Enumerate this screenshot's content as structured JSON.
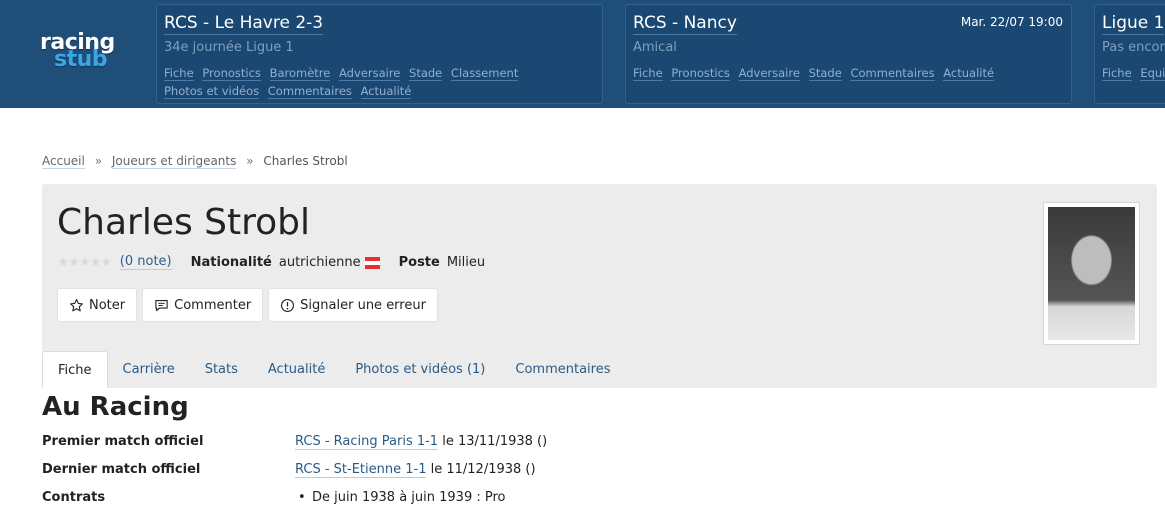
{
  "header": {
    "logo": {
      "word1": "racing",
      "word2": "stub"
    },
    "cards": [
      {
        "title": "RCS - Le Havre 2-3",
        "date": "",
        "subtitle": "34e journée Ligue 1",
        "links": [
          "Fiche",
          "Pronostics",
          "Baromètre",
          "Adversaire",
          "Stade",
          "Classement",
          "Photos et vidéos",
          "Commentaires",
          "Actualité"
        ]
      },
      {
        "title": "RCS - Nancy",
        "date": "Mar. 22/07 19:00",
        "subtitle": "Amical",
        "links": [
          "Fiche",
          "Pronostics",
          "Adversaire",
          "Stade",
          "Commentaires",
          "Actualité"
        ]
      },
      {
        "title": "Ligue 1",
        "date": "",
        "subtitle": "Pas encore",
        "links": [
          "Fiche",
          "Equipe"
        ]
      }
    ]
  },
  "breadcrumb": {
    "items": [
      "Accueil",
      "Joueurs et dirigeants"
    ],
    "separator": "»",
    "current": "Charles Strobl"
  },
  "profile": {
    "name": "Charles Strobl",
    "rating": {
      "stars": "★★★★★",
      "note_link": "(0 note)",
      "value": 0,
      "max": 5
    },
    "nationality_label": "Nationalité",
    "nationality_value": "autrichienne",
    "flag_colors": [
      "#e2342c",
      "#ffffff",
      "#e2342c"
    ],
    "position_label": "Poste",
    "position_value": "Milieu",
    "actions": [
      {
        "label": "Noter",
        "icon": "star-outline-icon"
      },
      {
        "label": "Commenter",
        "icon": "comment-icon"
      },
      {
        "label": "Signaler une erreur",
        "icon": "alert-circle-icon"
      }
    ]
  },
  "tabs": [
    {
      "label": "Fiche",
      "active": true
    },
    {
      "label": "Carrière",
      "active": false
    },
    {
      "label": "Stats",
      "active": false
    },
    {
      "label": "Actualité",
      "active": false
    },
    {
      "label": "Photos et vidéos (1)",
      "active": false
    },
    {
      "label": "Commentaires",
      "active": false
    }
  ],
  "content": {
    "section_title": "Au Racing",
    "first_match": {
      "label": "Premier match officiel",
      "match": "RCS - Racing Paris 1-1",
      "suffix": "le 13/11/1938 ()"
    },
    "last_match": {
      "label": "Dernier match officiel",
      "match": "RCS - St-Etienne 1-1",
      "suffix": "le 11/12/1938 ()"
    },
    "contracts": {
      "label": "Contrats",
      "items": [
        "De juin 1938 à juin 1939 : Pro"
      ]
    }
  },
  "colors": {
    "header_bg": "#1f4e79",
    "card_bg": "#1b4872",
    "link": "#2a5a86",
    "profile_bg": "#ececec"
  }
}
